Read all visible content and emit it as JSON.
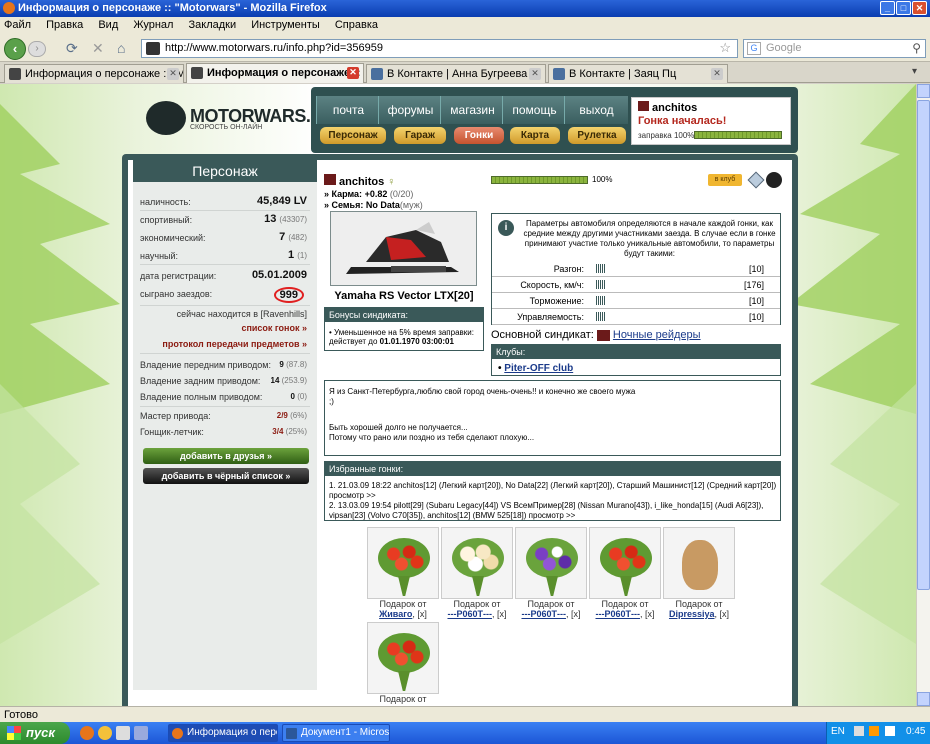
{
  "window": {
    "title": "Информация о персонаже :: \"Motorwars\" - Mozilla Firefox"
  },
  "menu": [
    "Файл",
    "Правка",
    "Вид",
    "Журнал",
    "Закладки",
    "Инструменты",
    "Справка"
  ],
  "nav": {
    "url": "http://www.motorwars.ru/info.php?id=356959",
    "search_placeholder": "Google"
  },
  "tabs": [
    {
      "label": "Информация о персонаже :: \"Motorw..."
    },
    {
      "label": "Информация о персонаже :: \"M..."
    },
    {
      "label": "В Контакте | Анна Бугреева"
    },
    {
      "label": "В Контакте | Заяц Пц"
    }
  ],
  "site": {
    "logo": "MOTORWARS.RU",
    "logo_sub": "СКОРОСТЬ ОН-ЛАЙН",
    "topnav": [
      "почта",
      "форумы",
      "магазин",
      "помощь",
      "выход"
    ],
    "buttons": [
      "Персонаж",
      "Гараж",
      "Гонки",
      "Карта",
      "Рулетка"
    ],
    "user": {
      "name": "anchitos",
      "status": "Гонка началась!",
      "fuel": "заправка 100%",
      "fuel_pct": 100
    }
  },
  "left": {
    "title": "Персонаж",
    "stats": [
      {
        "label": "наличность:",
        "value": "45,849 LV",
        "extra": ""
      },
      {
        "label": "спортивный:",
        "value": "13",
        "extra": "(43307)"
      },
      {
        "label": "экономический:",
        "value": "7",
        "extra": "(482)"
      },
      {
        "label": "научный:",
        "value": "1",
        "extra": "(1)"
      }
    ],
    "reg_label": "дата регистрации:",
    "reg_value": "05.01.2009",
    "races_label": "сыграно заездов:",
    "races_value": "999",
    "location": "сейчас находится в [Ravenhills]",
    "race_list": "список гонок »",
    "proto": "протокол передачи предметов »",
    "drive": [
      {
        "label": "Владение передним приводом:",
        "value": "9",
        "extra": "(87.8)"
      },
      {
        "label": "Владение задним приводом:",
        "value": "14",
        "extra": "(253.9)"
      },
      {
        "label": "Владение полным приводом:",
        "value": "0",
        "extra": "(0)"
      }
    ],
    "skills": [
      {
        "label": "Мастер привода:",
        "value": "2/9",
        "extra": "(6%)"
      },
      {
        "label": "Гонщик-летчик:",
        "value": "3/4",
        "extra": "(25%)"
      }
    ],
    "add_friend": "добавить в друзья »",
    "add_black": "добавить в чёрный список »"
  },
  "profile": {
    "name": "anchitos",
    "karma_label": "» Карма:",
    "karma": "+0.82",
    "karma_extra": "(0/20)",
    "family_label": "» Семья:",
    "family": "No Data",
    "family_extra": "(муж)",
    "progress": "100%",
    "progress_pct": 100,
    "badge": "в клуб",
    "vehicle": "Yamaha RS Vector LTX[20]",
    "bonus_title": "Бонусы синдиката:",
    "bonus_line1": "Уменьшенное на 5% время заправки:",
    "bonus_line2": "действует до",
    "bonus_date": "01.01.1970 03:00:01",
    "info_text": "Параметры автомобиля определяются в начале каждой гонки, как средние между другими участниками заезда. В случае если в гонке принимают участие только уникальные автомобили, то параметры будут такими:",
    "params": [
      {
        "label": "Разгон:",
        "value": "[10]"
      },
      {
        "label": "Скорость, км/ч:",
        "value": "[176]"
      },
      {
        "label": "Торможение:",
        "value": "[10]"
      },
      {
        "label": "Управляемость:",
        "value": "[10]"
      }
    ],
    "syndicate_label": "Основной синдикат:",
    "syndicate": "Ночные рейдеры",
    "clubs_title": "Клубы:",
    "club": "Piter-OFF club",
    "about_1": "Я из Санкт-Петербурга,люблю свой город очень-очень!! и конечно же своего мужа",
    "about_2": ";)",
    "about_3": "Быть хорошей долго не получается...",
    "about_4": "Потому что рано или поздно из тебя сделают плохую...",
    "fav_title": "Избранные гонки:",
    "fav_1": "1. 21.03.09 18:22 anchitos[12] (Легкий карт[20]), No Data[22] (Легкий карт[20]), Старший Машинист[12] (Средний карт[20]) просмотр >>",
    "fav_2": "2. 13.03.09 19:54 pilott[29] (Subaru Legacy[44]) VS ВсемПример[28] (Nissan Murano[43]), i_like_honda[15] (Audi A6[23]), vipsan[23] (Volvo C70[35]), anchitos[12] (BMW 525[18]) просмотр >>"
  },
  "gifts": [
    {
      "label": "Подарок от",
      "from": "Живаго",
      "x": "[x]",
      "type": "red"
    },
    {
      "label": "Подарок от",
      "from": "---Р060Т---",
      "x": "[x]",
      "type": "white"
    },
    {
      "label": "Подарок от",
      "from": "---Р060Т---",
      "x": "[x]",
      "type": "purple"
    },
    {
      "label": "Подарок от",
      "from": "---Р060Т---",
      "x": "[x]",
      "type": "red"
    },
    {
      "label": "Подарок от",
      "from": "Dipressiya",
      "x": "[x]",
      "type": "dog"
    },
    {
      "label": "Подарок от",
      "from": "",
      "x": "",
      "type": "red"
    }
  ],
  "statusbar": "Готово",
  "taskbar": {
    "start": "пуск",
    "items": [
      "Информация о персо...",
      "Документ1 - Microso..."
    ],
    "lang": "EN",
    "time": "0:45"
  }
}
